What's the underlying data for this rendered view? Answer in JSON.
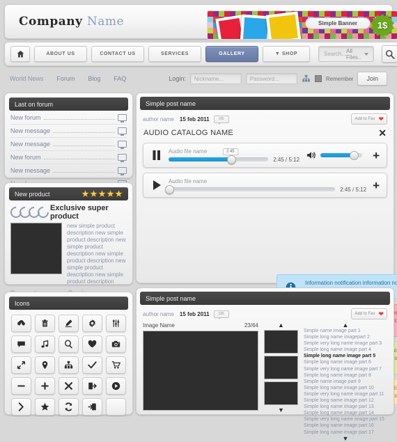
{
  "header": {
    "company_first": "Company",
    "company_second": "Name",
    "banner": {
      "pill_label": "Simple Banner",
      "price_label": "1$"
    }
  },
  "nav": {
    "items": [
      {
        "label": "",
        "icon": "home-icon",
        "active": false
      },
      {
        "label": "ABOUT US",
        "active": false
      },
      {
        "label": "CONTACT US",
        "active": false
      },
      {
        "label": "SERVICES",
        "active": false
      },
      {
        "label": "GALLERY",
        "active": true
      },
      {
        "label": "▼ SHOP",
        "active": false
      }
    ],
    "search_placeholder": "Search...",
    "search_filter": "All Files..",
    "search_icon": "magnifier-icon"
  },
  "subnav": {
    "links": [
      "World News",
      "Forum",
      "Blog",
      "FAQ"
    ],
    "login_label": "Login:",
    "nickname_placeholder": "Nickname...",
    "password_placeholder": "Password...",
    "remember_label": "Remember",
    "join_label": "Join"
  },
  "forum": {
    "title": "Last on forum",
    "rows": [
      "New forum",
      "New message",
      "New message",
      "New forum",
      "New message",
      "New forum"
    ]
  },
  "product": {
    "title": "New product",
    "rating": 5,
    "name": "Exclusive super product",
    "description": "new simple product description new simple product description new simple product description new simple product description new simple product description new simple product description",
    "buy_label": "Buy now!",
    "read_label": "Read more..."
  },
  "icons_panel": {
    "title": "Icons",
    "icons": [
      "cloud-download-icon",
      "trash-icon",
      "marker-pen-icon",
      "gear-icon",
      "sliders-icon",
      "chat-bubble-icon",
      "music-note-icon",
      "search-icon",
      "heart-icon",
      "camera-icon",
      "expand-arrows-icon",
      "map-pin-icon",
      "sitemap-icon",
      "check-icon",
      "shopping-cart-icon",
      "minus-icon",
      "plus-icon",
      "close-icon",
      "logout-icon",
      "play-circle-icon",
      "chevron-right-icon",
      "star-icon",
      "refresh-icon",
      "login-icon",
      "blank-icon"
    ]
  },
  "post_audio": {
    "title": "Simple post name",
    "author": "author name",
    "date": "15 feb 2011",
    "comments": "185",
    "fav_label": "Add to Fav",
    "catalog_title": "AUDIO CATALOG NAME",
    "close_label": "✕",
    "tracks": [
      {
        "name": "Audio file name",
        "state": "pause",
        "tooltip": "2:45",
        "time": "2:45 / 5:12",
        "progress_pct": 62,
        "volume_pct": 78,
        "has_volume": true,
        "add_label": "+"
      },
      {
        "name": "Audio file name",
        "state": "play",
        "tooltip": "",
        "time": "2:45 / 5:12",
        "progress_pct": 0,
        "volume_pct": 0,
        "has_volume": false,
        "add_label": "+"
      }
    ]
  },
  "notifications": [
    {
      "kind": "info",
      "icon": "info-circle-icon",
      "message": "Information notification information notification information notification information notification"
    },
    {
      "kind": "error",
      "icon": "cross-icon",
      "message": "Error notification error notification error notification error notification error notification error notification error notification error notification error notification error notification error notification"
    },
    {
      "kind": "success",
      "icon": "check-icon",
      "message": "Success notification success notification success notification success notificationsuccess notificationsuccess notification-success notificationsuccess notification"
    },
    {
      "kind": "warning",
      "icon": "warning-triangle-icon",
      "message": "Warning notification warning notification  warning notification warning notification warning notification warning notification warning notification warning notification"
    }
  ],
  "post_gallery": {
    "title": "Simple post name",
    "author": "author name",
    "date": "15 feb 2011",
    "comments": "185",
    "fav_label": "Add to Fav",
    "image_name": "Image Name",
    "counter": "23/64",
    "up_arrow": "▲",
    "down_arrow": "▼",
    "thumbs": 3,
    "list": [
      {
        "label": "Simple name image part 1",
        "selected": false
      },
      {
        "label": "Simple long name imagepart 2",
        "selected": false
      },
      {
        "label": "Simple very long name image part 3",
        "selected": false
      },
      {
        "label": "Simple long name image part 4",
        "selected": false
      },
      {
        "label": "Simple long name image part 5",
        "selected": true
      },
      {
        "label": "Simple long name image part 6",
        "selected": false
      },
      {
        "label": "Simple very long name image part 7",
        "selected": false
      },
      {
        "label": "Simple long name image part 8",
        "selected": false
      },
      {
        "label": "Simple name image part 9",
        "selected": false
      },
      {
        "label": "Simple long name image part 10",
        "selected": false
      },
      {
        "label": "Simple very long name image part 11",
        "selected": false
      },
      {
        "label": "Simple long name image part 12",
        "selected": false
      },
      {
        "label": "Simple long name image part 13",
        "selected": false
      },
      {
        "label": "Simple long name image part 14",
        "selected": false
      },
      {
        "label": "Simple very long name image part 15",
        "selected": false
      },
      {
        "label": "Simple long name image part 16",
        "selected": false
      },
      {
        "label": "Simple long name image part 17",
        "selected": false
      }
    ]
  },
  "colors": {
    "accent_blue": "#22a8e8",
    "nav_active": "#6678a4",
    "link": "#8a94ad",
    "dark_header": "#3f3f3f",
    "info": "#bfe4fa",
    "error": "#fbaeb4",
    "success": "#d3ef9a",
    "warning": "#fde9a6"
  }
}
